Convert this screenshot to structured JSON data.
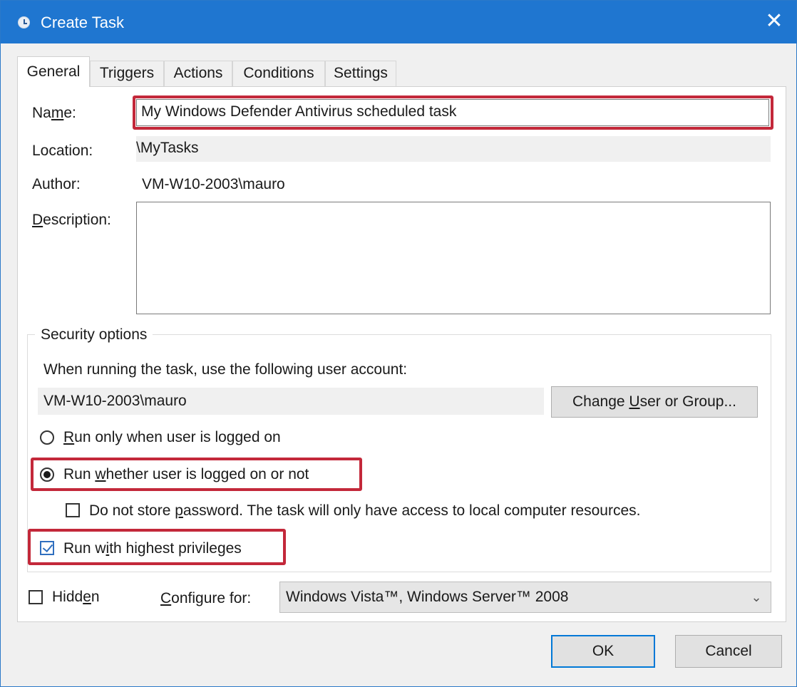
{
  "window": {
    "title": "Create Task",
    "close_glyph": "✕",
    "icon": "clock-icon",
    "accent": "#1f76d0",
    "highlight_color": "#c3283a"
  },
  "tabs": [
    {
      "label": "General",
      "active": true
    },
    {
      "label": "Triggers",
      "active": false
    },
    {
      "label": "Actions",
      "active": false
    },
    {
      "label": "Conditions",
      "active": false
    },
    {
      "label": "Settings",
      "active": false
    }
  ],
  "general": {
    "name_label_pre": "Na",
    "name_label_accel": "m",
    "name_label_post": "e:",
    "name_value": "My Windows Defender Antivirus scheduled task",
    "location_label": "Location:",
    "location_value": "\\MyTasks",
    "author_label": "Author:",
    "author_value": "VM-W10-2003\\mauro",
    "description_label_accel": "D",
    "description_label_post": "escription:",
    "description_value": ""
  },
  "security": {
    "title": "Security options",
    "account_prompt": "When running the task, use the following user account:",
    "account_value": "VM-W10-2003\\mauro",
    "change_button_pre": "Change ",
    "change_button_accel": "U",
    "change_button_post": "ser or Group...",
    "run_logged_on_accel": "R",
    "run_logged_on_post": "un only when user is logged on",
    "run_logged_on_checked": false,
    "run_whether_pre": "Run ",
    "run_whether_accel": "w",
    "run_whether_post": "hether user is logged on or not",
    "run_whether_checked": true,
    "no_store_pre": "Do not store ",
    "no_store_accel": "p",
    "no_store_post": "assword.  The task will only have access to local computer resources.",
    "no_store_checked": false,
    "highest_pre": "Run w",
    "highest_accel": "i",
    "highest_post": "th highest privileges",
    "highest_checked": true
  },
  "footer": {
    "hidden_pre": "Hidd",
    "hidden_accel": "e",
    "hidden_post": "n",
    "hidden_checked": false,
    "configure_accel": "C",
    "configure_post": "onfigure for:",
    "configure_value": "Windows Vista™, Windows Server™ 2008",
    "chevron": "⌄",
    "ok_label": "OK",
    "cancel_label": "Cancel"
  }
}
